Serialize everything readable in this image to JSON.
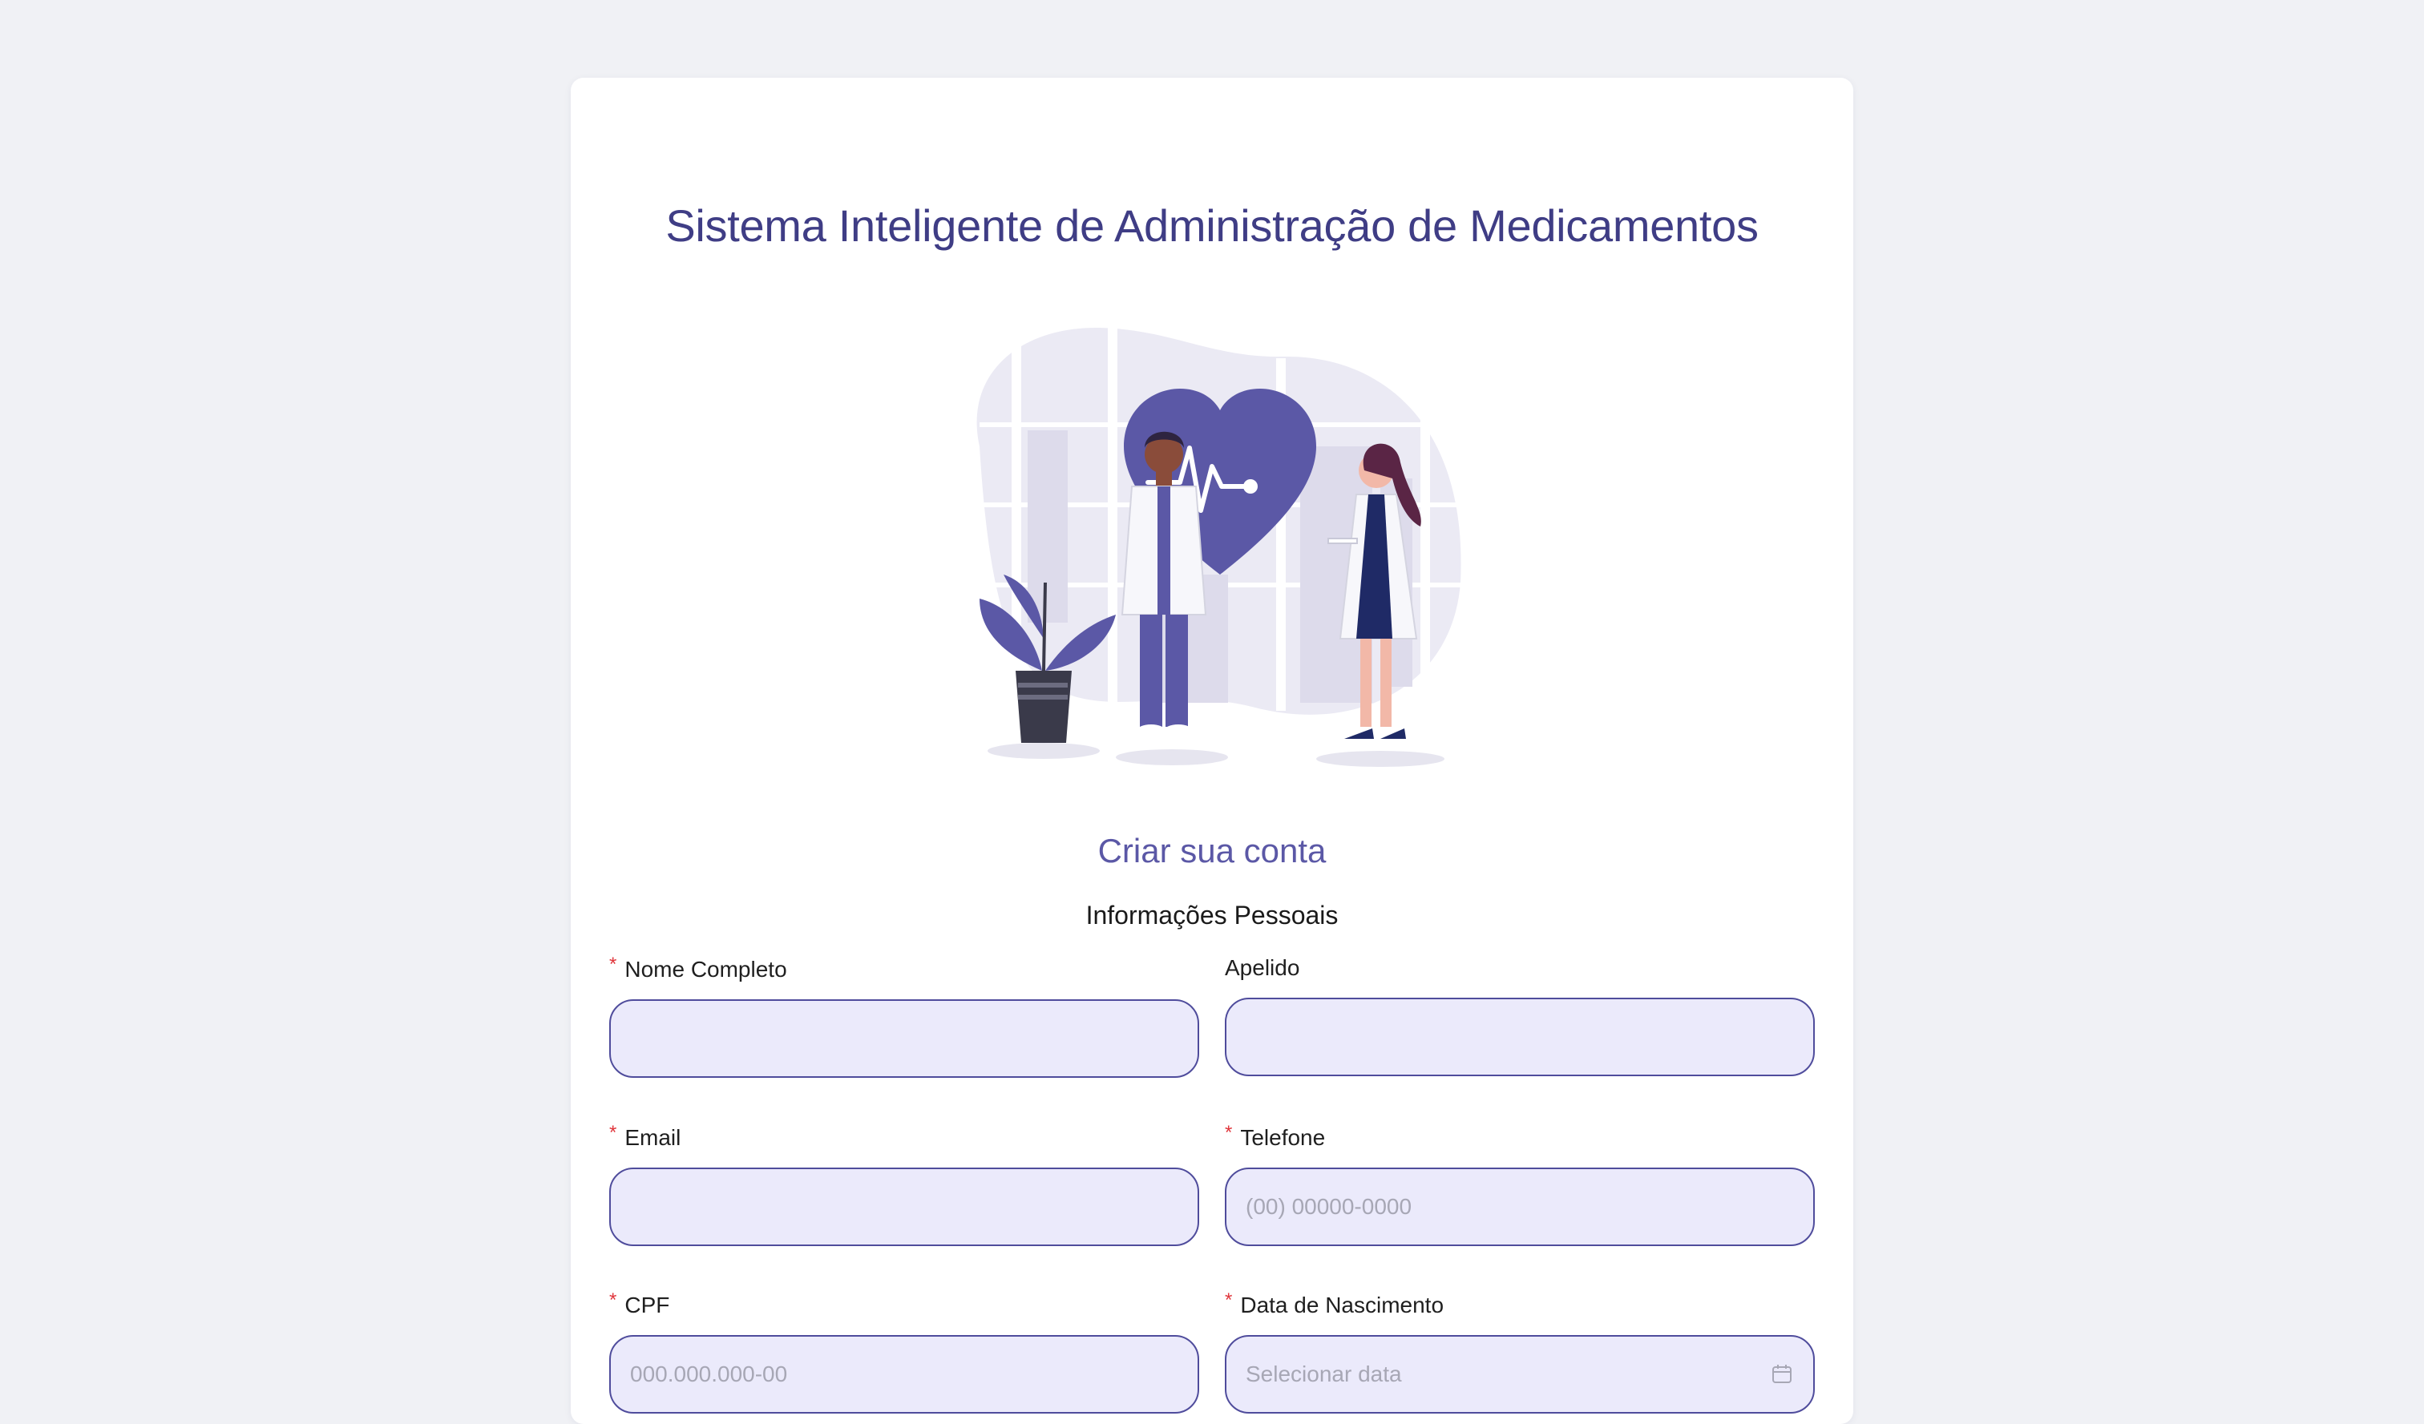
{
  "header": {
    "title": "Sistema Inteligente de Administração de Medicamentos"
  },
  "form": {
    "subtitle": "Criar sua conta",
    "section": "Informações Pessoais",
    "fields": {
      "nome": {
        "label": "Nome Completo",
        "required": "*",
        "placeholder": "",
        "value": ""
      },
      "apelido": {
        "label": "Apelido",
        "placeholder": "",
        "value": ""
      },
      "email": {
        "label": "Email",
        "required": "*",
        "placeholder": "",
        "value": ""
      },
      "telefone": {
        "label": "Telefone",
        "required": "*",
        "placeholder": "(00) 00000-0000",
        "value": ""
      },
      "cpf": {
        "label": "CPF",
        "required": "*",
        "placeholder": "000.000.000-00",
        "value": ""
      },
      "nascimento": {
        "label": "Data de Nascimento",
        "required": "*",
        "placeholder": "Selecionar data",
        "value": "",
        "icon": "calendar-icon"
      }
    }
  },
  "colors": {
    "page_background": "#f0f1f5",
    "title": "#3f3d85",
    "accent": "#5b58a6",
    "input_background": "#ebeafb",
    "input_border": "#4f4c9c",
    "required_mark": "#e0353b"
  }
}
